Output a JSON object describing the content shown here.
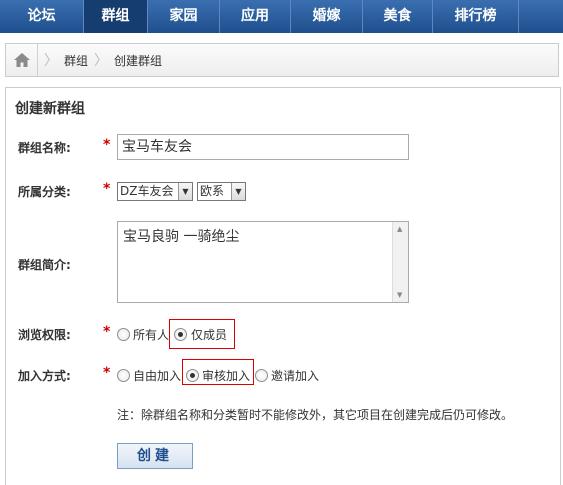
{
  "nav": {
    "items": [
      {
        "label": "论坛"
      },
      {
        "label": "群组"
      },
      {
        "label": "家园"
      },
      {
        "label": "应用"
      },
      {
        "label": "婚嫁"
      },
      {
        "label": "美食"
      },
      {
        "label": "排行榜"
      }
    ],
    "active_index": 1
  },
  "breadcrumb": {
    "icon": "home-icon",
    "items": [
      "群组",
      "创建群组"
    ]
  },
  "form": {
    "title": "创建新群组",
    "required_mark": "*",
    "name_label": "群组名称:",
    "name_value": "宝马车友会",
    "category_label": "所属分类:",
    "category_value": "DZ车友会",
    "subcategory_value": "欧系",
    "intro_label": "群组简介:",
    "intro_value": "宝马良驹 一骑绝尘",
    "browse_label": "浏览权限:",
    "browse_options": [
      "所有人",
      "仅成员"
    ],
    "browse_selected": "仅成员",
    "join_label": "加入方式:",
    "join_options": [
      "自由加入",
      "审核加入",
      "邀请加入"
    ],
    "join_selected": "审核加入",
    "note": "注：除群组名称和分类暂时不能修改外，其它项目在创建完成后仍可修改。",
    "submit_label": "创建"
  },
  "colors": {
    "nav_bg": "#2a5c9e",
    "nav_active": "#163d70",
    "required": "#cc0000",
    "highlight_box": "#dd0000"
  }
}
